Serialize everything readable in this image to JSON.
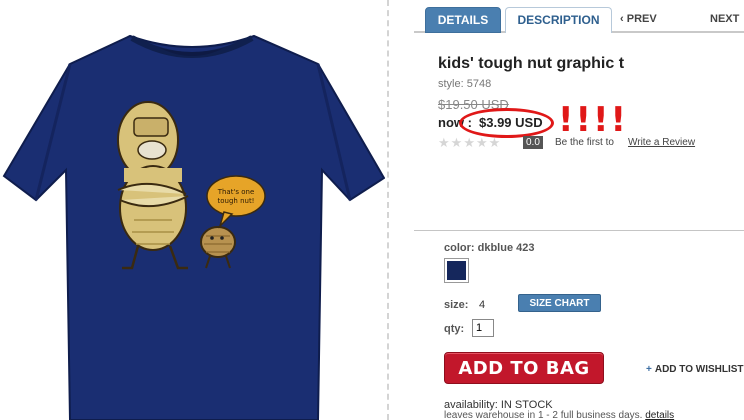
{
  "tabs": {
    "details": "DETAILS",
    "description": "DESCRIPTION",
    "prev": "PREV",
    "next": "NEXT"
  },
  "product": {
    "title": "kids' tough nut graphic t",
    "style": "style: 5748",
    "was_price": "$19.50 USD",
    "now_label": "now :",
    "now_price": "$3.99 USD",
    "annotation": "!!!!"
  },
  "rating": {
    "stars_filled": 0,
    "stars_total": 5,
    "score": "0.0",
    "be_first": "Be the first to",
    "write_review": "Write a Review"
  },
  "color": {
    "label": "color: dkblue 423",
    "swatch_hex": "#15275c"
  },
  "size": {
    "label": "size:",
    "value": "4",
    "chart_button": "SIZE CHART"
  },
  "qty": {
    "label": "qty:",
    "value": "1"
  },
  "actions": {
    "add_to_bag": "ADD TO BAG",
    "wishlist": "ADD TO WISHLIST"
  },
  "availability": {
    "status": "availability: IN STOCK",
    "leaves": "leaves warehouse in 1 - 2 full business days.",
    "details_link": "details"
  },
  "image": {
    "speech_bubble": "That's one tough nut!",
    "shirt_color": "#1a2e72",
    "accent_red": "#e01818",
    "link_blue": "#4a7fb0"
  }
}
